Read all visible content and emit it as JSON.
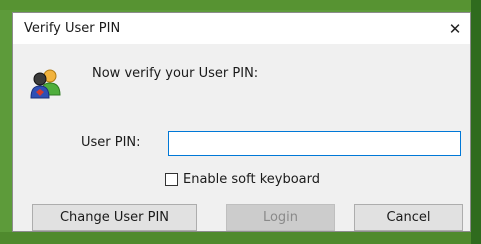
{
  "dialog": {
    "title": "Verify User PIN",
    "close_symbol": "✕",
    "icon": "users-icon",
    "prompt": "Now verify your User PIN:",
    "pin_label": "User PIN:",
    "pin_value": "",
    "soft_keyboard_label": "Enable soft keyboard",
    "soft_keyboard_checked": false,
    "buttons": {
      "change_pin": "Change User PIN",
      "login": "Login",
      "cancel": "Cancel"
    }
  },
  "colors": {
    "desktop_background": "#5d9b3a",
    "dialog_background": "#f0f0f0",
    "input_focus_border": "#0078d7"
  }
}
